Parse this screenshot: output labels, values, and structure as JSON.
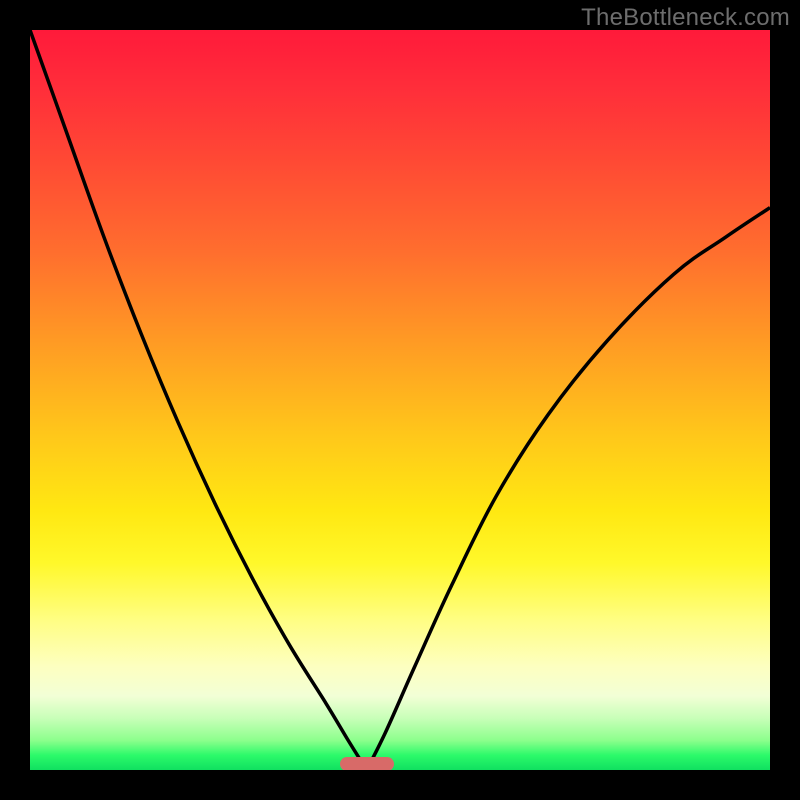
{
  "watermark": "TheBottleneck.com",
  "marker": {
    "x_fraction": 0.455,
    "color": "#d86a68"
  },
  "chart_data": {
    "type": "line",
    "title": "",
    "xlabel": "",
    "ylabel": "",
    "xlim": [
      0,
      1
    ],
    "ylim": [
      0,
      1
    ],
    "notes": "Two V-shaped curves meeting at x≈0.455 (bottleneck optimum). Background gradient red→yellow→green encodes score: top=bad, bottom=good.",
    "series": [
      {
        "name": "left-curve",
        "x": [
          0.0,
          0.05,
          0.1,
          0.15,
          0.2,
          0.25,
          0.3,
          0.35,
          0.4,
          0.43,
          0.455
        ],
        "y": [
          1.0,
          0.86,
          0.72,
          0.59,
          0.47,
          0.36,
          0.26,
          0.17,
          0.09,
          0.04,
          0.0
        ]
      },
      {
        "name": "right-curve",
        "x": [
          0.455,
          0.48,
          0.52,
          0.57,
          0.63,
          0.7,
          0.78,
          0.87,
          0.94,
          1.0
        ],
        "y": [
          0.0,
          0.05,
          0.14,
          0.25,
          0.37,
          0.48,
          0.58,
          0.67,
          0.72,
          0.76
        ]
      }
    ],
    "gradient_stops": [
      {
        "pos": 0.0,
        "color": "#ff1a3a"
      },
      {
        "pos": 0.3,
        "color": "#ff6e2e"
      },
      {
        "pos": 0.55,
        "color": "#ffc81a"
      },
      {
        "pos": 0.72,
        "color": "#fff82a"
      },
      {
        "pos": 0.86,
        "color": "#fdffc0"
      },
      {
        "pos": 0.96,
        "color": "#8cff8c"
      },
      {
        "pos": 1.0,
        "color": "#10e060"
      }
    ]
  }
}
